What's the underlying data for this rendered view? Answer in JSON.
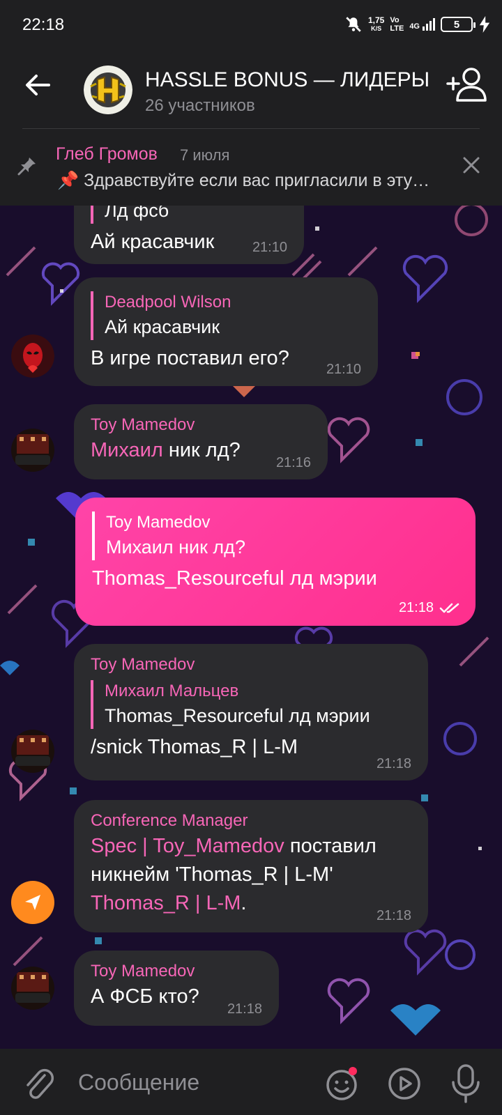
{
  "status_bar": {
    "time": "22:18",
    "net_speed_value": "1,75",
    "net_speed_unit": "K/S",
    "volte_top": "Vo",
    "volte_bottom": "LTE",
    "network": "4G",
    "battery": "5"
  },
  "header": {
    "title": "HASSLE BONUS — ЛИДЕРЫ",
    "subtitle": "26 участников"
  },
  "pinned": {
    "author": "Глеб Громов",
    "date": "7 июля",
    "text": "📌 Здравствуйте если вас пригласили в эту беседу"
  },
  "messages": [
    {
      "quote_text": "Лд фсб",
      "text": "Ай красавчик",
      "time": "21:10"
    },
    {
      "quote_author": "Deadpool Wilson",
      "quote_text": "Ай красавчик",
      "text": "В игре поставил его?",
      "time": "21:10"
    },
    {
      "sender": "Toy Mamedov",
      "mention": "Михаил",
      "text": " ник лд?",
      "time": "21:16"
    },
    {
      "quote_author": "Toy Mamedov",
      "quote_text": "Михаил ник лд?",
      "text": "Thomas_Resourceful лд мэрии",
      "time": "21:18"
    },
    {
      "sender": "Toy Mamedov",
      "quote_author": "Михаил Мальцев",
      "quote_text": "Thomas_Resourceful лд мэрии",
      "text": "/snick Thomas_R | L-M",
      "time": "21:18"
    },
    {
      "sender": "Conference Manager",
      "mention1": "Spec | Toy_Mamedov",
      "text1": " поставил никнейм 'Thomas_R | L-M'",
      "mention2": "Thomas_R | L-M",
      "text2": ".",
      "time": "21:18"
    },
    {
      "sender": "Toy Mamedov",
      "text": "А ФСБ кто?",
      "time": "21:18"
    }
  ],
  "composer": {
    "placeholder": "Сообщение"
  },
  "colors": {
    "accent": "#f766b7",
    "outgoing": "#ff3d9a",
    "bubble": "#2b2b2e",
    "wallpaper": "#190d2c",
    "fab": "#ff8a1e"
  }
}
